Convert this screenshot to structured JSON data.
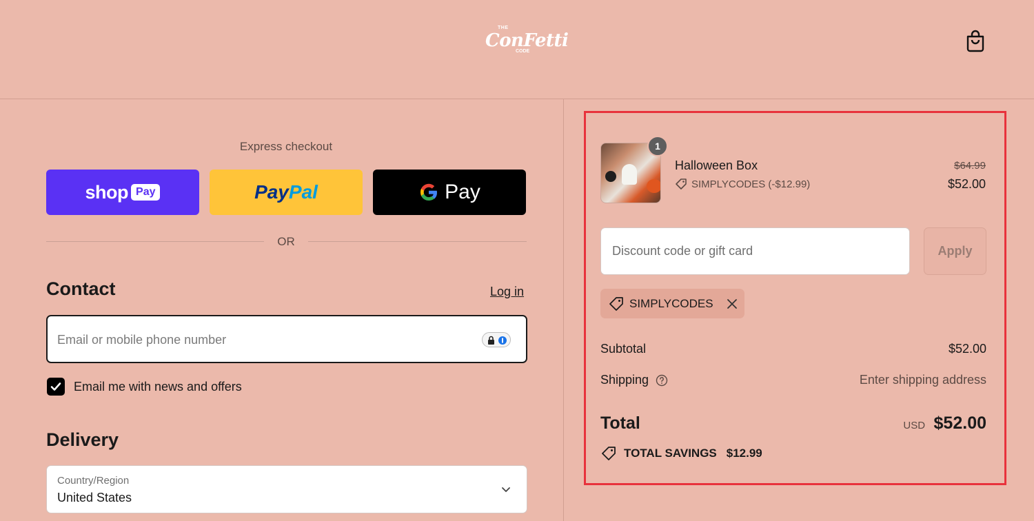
{
  "header": {
    "logo": {
      "the": "THE",
      "main": "ConFetti",
      "code": "CODE"
    },
    "cart_icon": "shopping-bag-icon"
  },
  "express": {
    "label": "Express checkout",
    "shop_pay": {
      "shop": "shop",
      "pay": "Pay"
    },
    "paypal": {
      "part1": "Pay",
      "part2": "Pal"
    },
    "gpay": {
      "g": "G",
      "text": "Pay"
    },
    "or": "OR"
  },
  "contact": {
    "heading": "Contact",
    "login": "Log in",
    "email_placeholder": "Email or mobile phone number",
    "email_value": "",
    "newsletter_label": "Email me with news and offers",
    "newsletter_checked": true
  },
  "delivery": {
    "heading": "Delivery",
    "country_label": "Country/Region",
    "country_value": "United States"
  },
  "summary": {
    "item": {
      "name": "Halloween Box",
      "quantity": "1",
      "discount": "SIMPLYCODES (-$12.99)",
      "original_price": "$64.99",
      "price": "$52.00"
    },
    "discount_placeholder": "Discount code or gift card",
    "apply_label": "Apply",
    "applied_code": "SIMPLYCODES",
    "subtotal_label": "Subtotal",
    "subtotal_value": "$52.00",
    "shipping_label": "Shipping",
    "shipping_value": "Enter shipping address",
    "total_label": "Total",
    "total_currency": "USD",
    "total_value": "$52.00",
    "savings_label": "TOTAL SAVINGS",
    "savings_value": "$12.99"
  },
  "colors": {
    "background": "#ebb9ab",
    "shop_pay": "#5a31f4",
    "paypal": "#ffc439",
    "gpay": "#000000",
    "highlight_box": "#e8323c"
  }
}
